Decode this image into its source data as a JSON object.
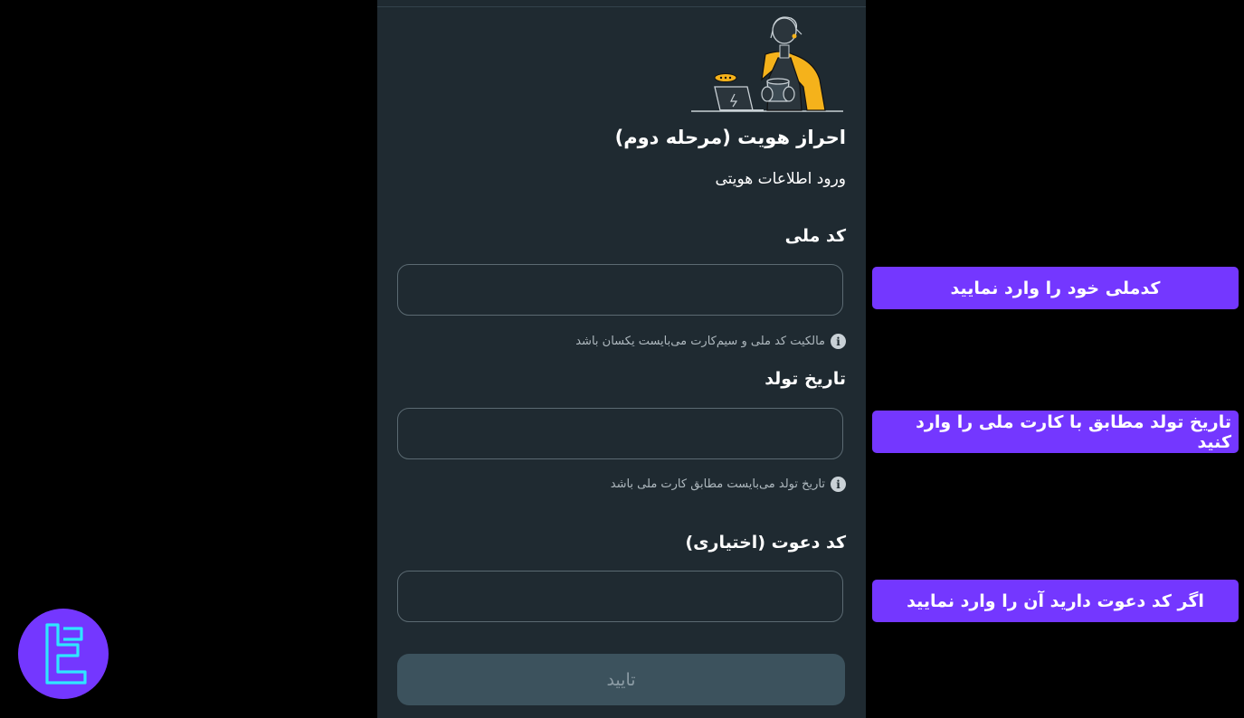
{
  "form": {
    "title": "احراز هویت (مرحله دوم)",
    "subtitle": "ورود اطلاعات هویتی",
    "national_code": {
      "label": "کد ملی",
      "value": "",
      "hint": "مالکیت کد ملی و سیم‌کارت می‌بایست یکسان باشد"
    },
    "birth_date": {
      "label": "تاریخ تولد",
      "value": "",
      "hint": "تاریخ تولد می‌بایست مطابق کارت ملی باشد"
    },
    "invite_code": {
      "label": "کد دعوت (اختیاری)",
      "value": ""
    },
    "submit_label": "تایید"
  },
  "callouts": [
    "کدملی خود را وارد نمایید",
    "تاریخ تولد مطابق با کارت ملی را وارد کنید",
    "اگر کد دعوت دارید آن را وارد نمایید"
  ],
  "icons": {
    "illustration": "person-with-laptop-illustration",
    "info": "info-icon",
    "logo": "brand-logo"
  },
  "colors": {
    "phone_background": "#1f2a31",
    "callout_accent": "#7437ff",
    "submit_disabled": "#3c525d",
    "illustration_accent": "#f5b21b"
  }
}
